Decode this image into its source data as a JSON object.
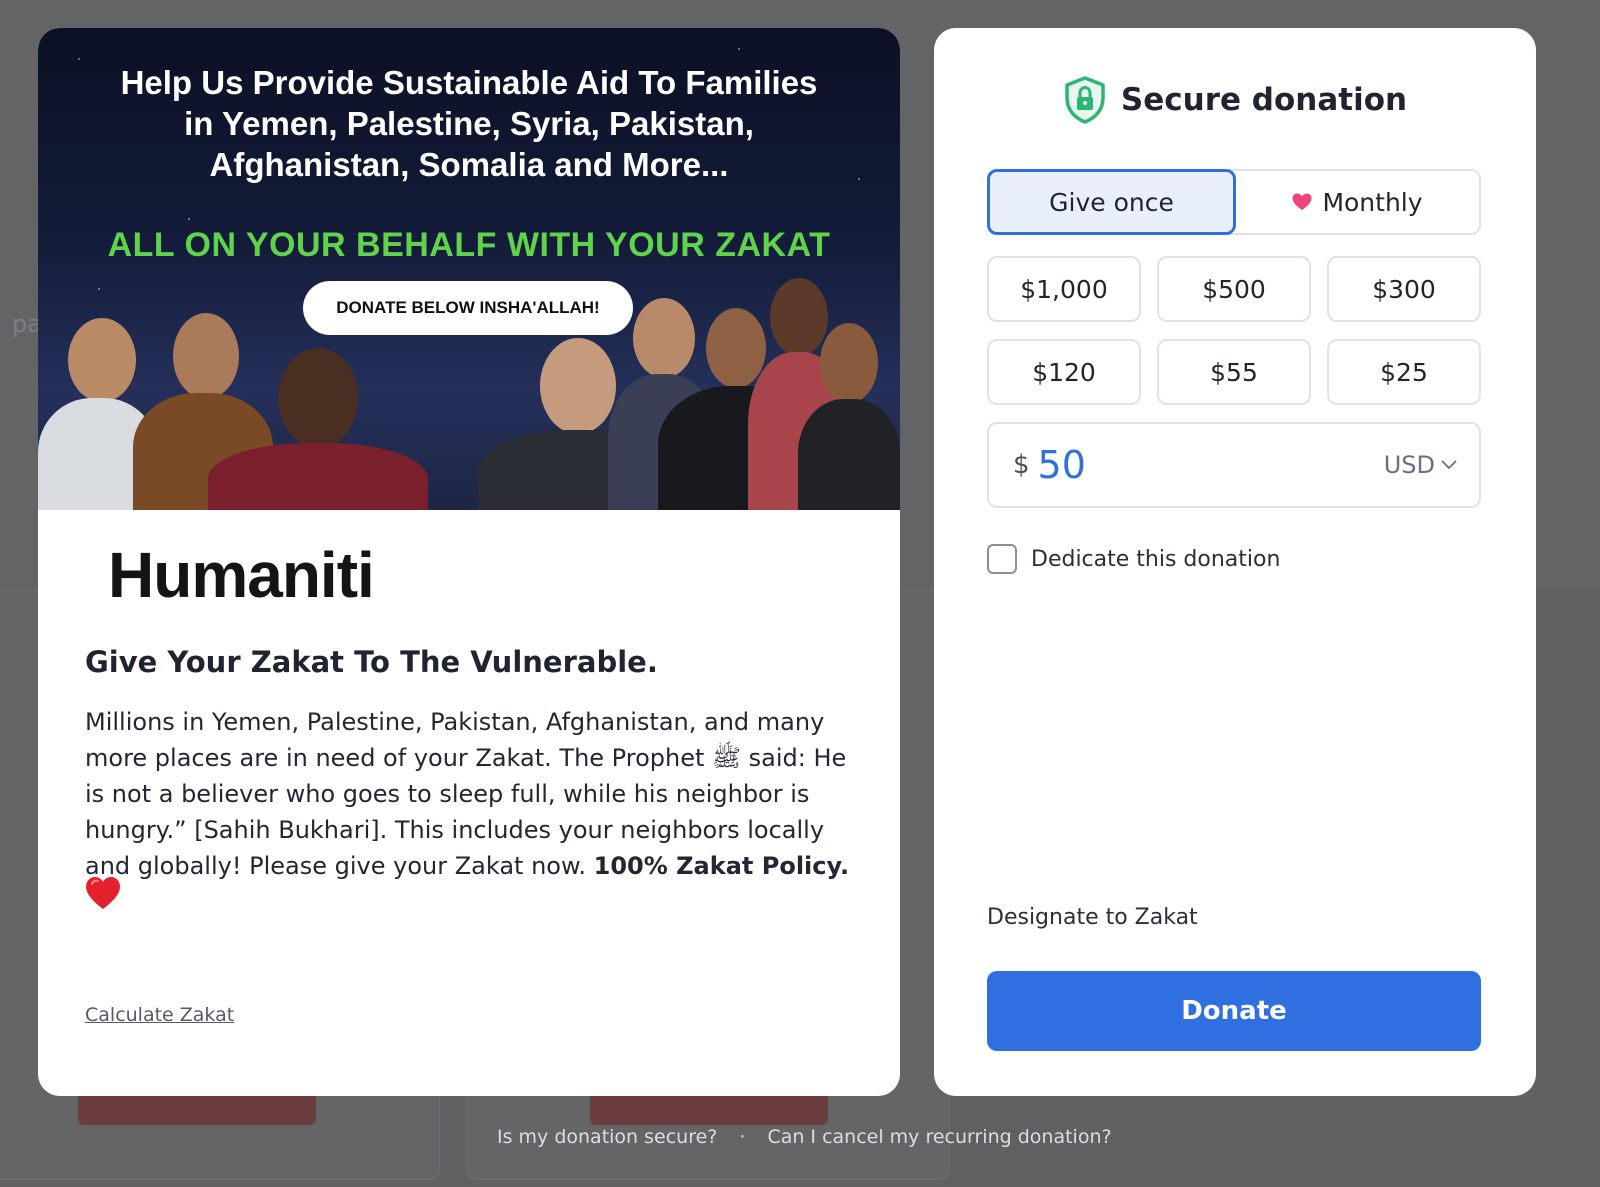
{
  "background": {
    "fragment_text": "pa"
  },
  "hero": {
    "title_lines": [
      "Help Us Provide Sustainable Aid To Families",
      "in Yemen, Palestine, Syria, Pakistan,",
      "Afghanistan, Somalia and More..."
    ],
    "subtitle": "ALL ON YOUR BEHALF WITH YOUR ZAKAT",
    "pill": "DONATE BELOW INSHA'ALLAH!"
  },
  "campaign": {
    "logo": "Humaniti",
    "headline": "Give Your Zakat To The Vulnerable.",
    "body": "Millions in Yemen, Palestine, Pakistan, Afghanistan, and many more places are in need of your Zakat. The Prophet ﷺ said: He is not a believer who goes to sleep full, while his neighbor is hungry.” [Sahih Bukhari]. This includes your neighbors locally and globally! Please give your Zakat now. ",
    "body_bold": "100% Zakat Policy.",
    "calc_link": "Calculate Zakat"
  },
  "donation": {
    "title": "Secure donation",
    "tab_once": "Give once",
    "tab_monthly": "Monthly",
    "amounts": [
      "$1,000",
      "$500",
      "$300",
      "$120",
      "$55",
      "$25"
    ],
    "currency_symbol": "$",
    "amount_value": "50",
    "currency": "USD",
    "dedicate_label": "Dedicate this donation",
    "designate_label": "Designate to Zakat",
    "donate_button": "Donate"
  },
  "footer": {
    "link_secure": "Is my donation secure?",
    "separator": "·",
    "link_cancel": "Can I cancel my recurring donation?"
  },
  "colors": {
    "accent": "#2f6fe0",
    "shield": "#2bb673",
    "heart": "#f0457a",
    "hero_green": "#5fd34b"
  },
  "icons": [
    "shield-lock-icon",
    "heart-icon",
    "chevron-down-icon",
    "heart-emoji-icon"
  ]
}
